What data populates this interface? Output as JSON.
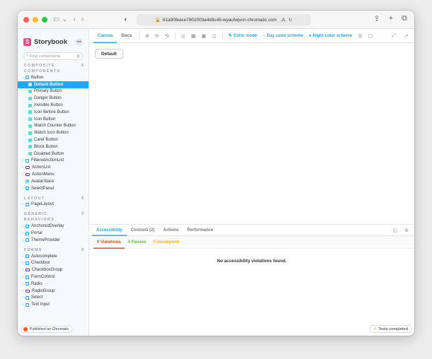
{
  "browser": {
    "url": "61a90feace7802003a4d9c45-wyaufwjvcn.chromatic.com",
    "colors": {
      "close": "#ff5f57",
      "minimize": "#febc2e",
      "maximize": "#28c840"
    }
  },
  "sidebar": {
    "brand": "Storybook",
    "search_placeholder": "Find components",
    "search_shortcut": "/",
    "sections": [
      {
        "title": "COMPOSITE COMPONENTS",
        "items": [
          {
            "label": "Button",
            "level": 1,
            "kind": "component",
            "expanded": true
          },
          {
            "label": "Default Button",
            "level": 2,
            "kind": "story",
            "selected": true
          },
          {
            "label": "Primary Button",
            "level": 2,
            "kind": "story"
          },
          {
            "label": "Danger Button",
            "level": 2,
            "kind": "story"
          },
          {
            "label": "Invisible Button",
            "level": 2,
            "kind": "story"
          },
          {
            "label": "Icon Before Button",
            "level": 2,
            "kind": "story"
          },
          {
            "label": "Icon Button",
            "level": 2,
            "kind": "story"
          },
          {
            "label": "Watch Counter Button",
            "level": 2,
            "kind": "story"
          },
          {
            "label": "Watch Icon Button",
            "level": 2,
            "kind": "story"
          },
          {
            "label": "Caret Button",
            "level": 2,
            "kind": "story"
          },
          {
            "label": "Block Button",
            "level": 2,
            "kind": "story"
          },
          {
            "label": "Disabled Button",
            "level": 2,
            "kind": "story"
          },
          {
            "label": "FilteredActionList",
            "level": 1,
            "kind": "component"
          },
          {
            "label": "ActionList",
            "level": 1,
            "kind": "folder"
          },
          {
            "label": "ActionMenu",
            "level": 1,
            "kind": "folder"
          },
          {
            "label": "AvatarStack",
            "level": 1,
            "kind": "story-only"
          },
          {
            "label": "SelectPanel",
            "level": 1,
            "kind": "component"
          }
        ]
      },
      {
        "title": "LAYOUT",
        "items": [
          {
            "label": "PageLayout",
            "level": 1,
            "kind": "component"
          }
        ]
      },
      {
        "title": "GENERIC BEHAVIORS",
        "items": [
          {
            "label": "AnchoredOverlay",
            "level": 1,
            "kind": "component"
          },
          {
            "label": "Portal",
            "level": 1,
            "kind": "component"
          },
          {
            "label": "ThemeProvider",
            "level": 1,
            "kind": "component"
          }
        ]
      },
      {
        "title": "FORMS",
        "items": [
          {
            "label": "Autocomplete",
            "level": 1,
            "kind": "component"
          },
          {
            "label": "Checkbox",
            "level": 1,
            "kind": "component"
          },
          {
            "label": "CheckboxGroup",
            "level": 1,
            "kind": "folder"
          },
          {
            "label": "FormControl",
            "level": 1,
            "kind": "component"
          },
          {
            "label": "Radio",
            "level": 1,
            "kind": "component"
          },
          {
            "label": "RadioGroup",
            "level": 1,
            "kind": "folder"
          },
          {
            "label": "Select",
            "level": 1,
            "kind": "component"
          },
          {
            "label": "Text Input",
            "level": 1,
            "kind": "component"
          }
        ]
      }
    ],
    "published": "Published on Chromatic"
  },
  "toolbar": {
    "tab_canvas": "Canvas",
    "tab_docs": "Docs",
    "color_mode": "Color mode",
    "day_scheme": "Day color scheme",
    "night_scheme": "Night color scheme"
  },
  "canvas": {
    "default_button": "Default"
  },
  "addons": {
    "tabs": [
      "Accessibility",
      "Controls (2)",
      "Actions",
      "Performance"
    ],
    "violations": "0 Violations",
    "passes": "4 Passes",
    "incomplete": "0 Incomplete",
    "message": "No accessibility violations found.",
    "tests": "Tests completed"
  }
}
